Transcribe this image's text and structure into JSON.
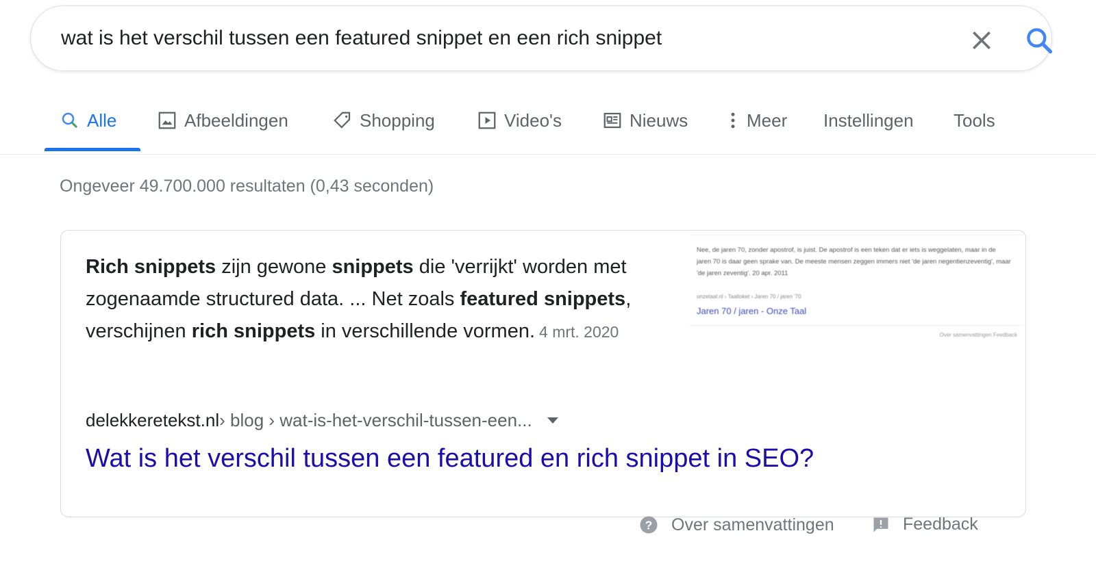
{
  "search": {
    "query": "wat is het verschil tussen een featured snippet en een rich snippet"
  },
  "tabs": [
    {
      "label": "Alle",
      "icon": "search-icon",
      "active": true
    },
    {
      "label": "Afbeeldingen",
      "icon": "image-icon"
    },
    {
      "label": "Shopping",
      "icon": "tag-icon"
    },
    {
      "label": "Video's",
      "icon": "play-icon"
    },
    {
      "label": "Nieuws",
      "icon": "news-icon"
    },
    {
      "label": "Meer",
      "icon": "more-vert-icon"
    },
    {
      "label": "Instellingen"
    },
    {
      "label": "Tools"
    }
  ],
  "stats": "Ongeveer 49.700.000 resultaten (0,43 seconden)",
  "featured": {
    "snippet_parts": [
      {
        "b": true,
        "t": "Rich snippets"
      },
      {
        "b": false,
        "t": " zijn gewone "
      },
      {
        "b": true,
        "t": "snippets"
      },
      {
        "b": false,
        "t": " die 'verrijkt' worden met zogenaamde structured data. ... Net zoals "
      },
      {
        "b": true,
        "t": "featured snippets"
      },
      {
        "b": false,
        "t": ", verschijnen "
      },
      {
        "b": true,
        "t": "rich snippets"
      },
      {
        "b": false,
        "t": " in verschillende vormen."
      }
    ],
    "date": "4 mrt. 2020",
    "thumbnail": {
      "text": "Nee, de jaren 70, zonder apostrof, is juist. De apostrof is een teken dat er iets is weggelaten, maar in de jaren 70 is daar geen sprake van. De meeste mensen zeggen immers niet 'de jaren negentienzeventig', maar 'de jaren zeventig'. 20 apr. 2011",
      "url": "onzetaal.nl › Taalloket › Jaren 70 / jaren '70",
      "link": "Jaren 70 / jaren - Onze Taal",
      "footer": "Over samenvattingen   Feedback"
    },
    "domain": "delekkeretekst.nl",
    "path": " › blog › wat-is-het-verschil-tussen-een...",
    "title": "Wat is het verschil tussen een featured en rich snippet in SEO?"
  },
  "footer": {
    "about": "Over samenvattingen",
    "feedback": "Feedback"
  },
  "colors": {
    "accent": "#1a73e8",
    "link": "#1a0dab",
    "muted": "#70757a"
  }
}
